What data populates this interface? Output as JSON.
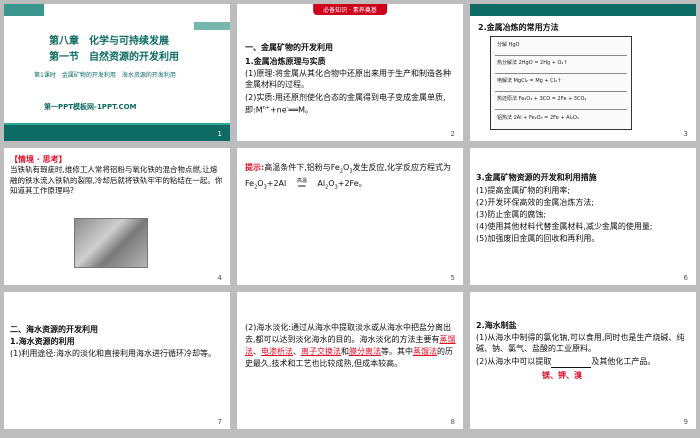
{
  "slides": {
    "s1": {
      "chapter": "第八章　化学与可持续发展",
      "section": "第一节　自然资源的开发利用",
      "lesson": "第1课时　金属矿物的开发利用　海水资源的开发利用",
      "footer": "第一PPT模板网-1PPT.COM",
      "num": "1"
    },
    "s2": {
      "badge": "必备知识 · 素养奠基",
      "h1": "一、金属矿物的开发利用",
      "h2": "1.金属冶炼原理与实质",
      "p1": "(1)原理:将金属从其化合物中还原出来用于生产和制造各种金属材料的过程。",
      "p2": "(2)实质:用还原剂使化合态的金属得到电子变成金属单质,即:M",
      "p2b": "+ne",
      "p2c": "══M。",
      "num": "2"
    },
    "s3": {
      "h": "2.金属冶炼的常用方法",
      "diagram_rows": [
        "分解 HgO",
        "热分解法 2HgO = 2Hg + O₂↑",
        "电解法 MgCl₂ = Mg + Cl₂↑",
        "热还原法 Fe₂O₃ + 3CO = 2Fe + 3CO₂",
        "铝热法 2Al + Fe₂O₃ = 2Fe + Al₂O₃"
      ],
      "num": "3"
    },
    "s4": {
      "tag": "【情境 · 思考】",
      "p": "当铁轨有瑕疵时,维修工人常将铝粉与氧化铁的混合物点燃,让熔融的铁水流入铁轨的裂隙,冷却后就将铁轨牢牢的粘结在一起。你知道其工作原理吗?",
      "num": "4"
    },
    "s5": {
      "label": "提示:",
      "p1": "高温条件下,铝粉与Fe",
      "p1b": "O",
      "p1c": "发生反应,化学反应方程式为Fe",
      "p2": "O",
      "p2b": "+2Al",
      "cond": "高温",
      "p2c": "Al",
      "p2d": "O",
      "p2e": "+2Fe。",
      "num": "5"
    },
    "s6": {
      "h": "3.金属矿物资源的开发和利用措施",
      "items": [
        "(1)提高金属矿物的利用率;",
        "(2)开发环保高效的金属冶炼方法;",
        "(3)防止金属的腐蚀;",
        "(4)使用其他材料代替金属材料,减少金属的使用量;",
        "(5)加强废旧金属的回收和再利用。"
      ],
      "num": "6"
    },
    "s7": {
      "h1": "二、海水资源的开发利用",
      "h2": "1.海水资源的利用",
      "p": "(1)利用途径:海水的淡化和直接利用海水进行循环冷却等。",
      "num": "7"
    },
    "s8": {
      "p_a": "(2)海水淡化:通过从海水中提取淡水或从海水中把盐分离出去,都可以达到淡化海水的目的。海水淡化的方法主要有",
      "m1": "蒸馏法",
      "m2": "电渗析法",
      "m3": "离子交换法",
      "p_b": "和",
      "m4": "膜分离法",
      "p_c": "等。其中",
      "m5": "蒸馏法",
      "p_d": "的历史最久,技术和工艺也比较成熟,但成本较高。",
      "num": "8"
    },
    "s9": {
      "h": "2.海水制盐",
      "p1": "(1)从海水中制得的氯化钠,可以食用,同时也是生产烧碱、纯碱、钠、氯气、盐酸的工业原料。",
      "p2a": "(2)从海水中可以提取",
      "p2b": "及其他化工产品。",
      "ans": "镁、钾、溴",
      "num": "9"
    }
  }
}
